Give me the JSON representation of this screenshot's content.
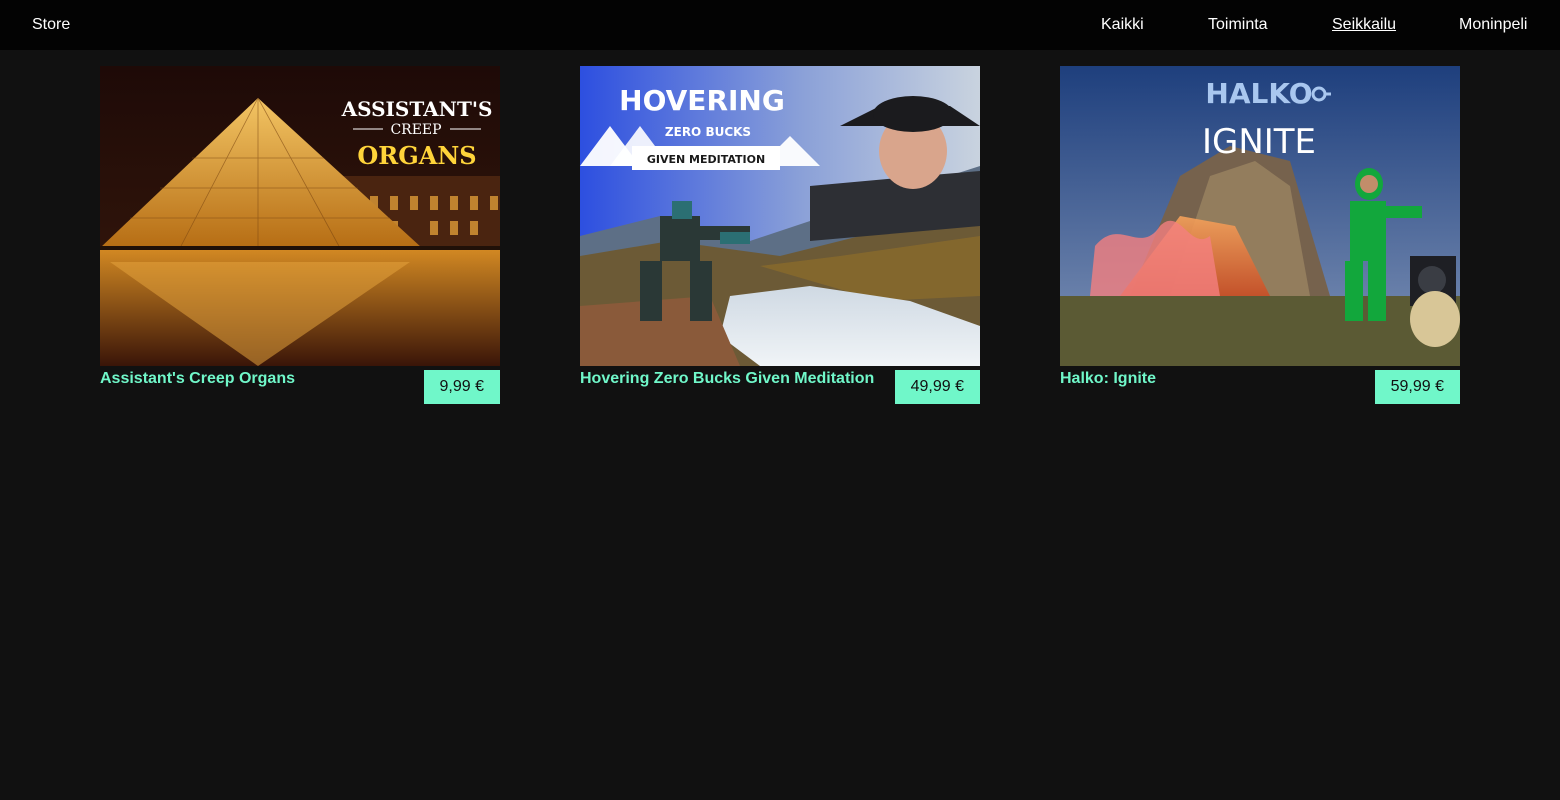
{
  "header": {
    "brand": "Store",
    "nav": [
      {
        "label": "Kaikki",
        "active": false
      },
      {
        "label": "Toiminta",
        "active": false
      },
      {
        "label": "Seikkailu",
        "active": true
      },
      {
        "label": "Moninpeli",
        "active": false
      }
    ]
  },
  "games": [
    {
      "title": "Assistant's Creep Organs",
      "price": "9,99 €",
      "cover": {
        "line1": "ASSISTANT'S",
        "line2": "CREEP",
        "line3": "ORGANS"
      }
    },
    {
      "title": "Hovering Zero Bucks Given Meditation",
      "price": "49,99 €",
      "cover": {
        "line1": "HOVERING",
        "line2": "ZERO BUCKS",
        "line3": "GIVEN MEDITATION"
      }
    },
    {
      "title": "Halko: Ignite",
      "price": "59,99 €",
      "cover": {
        "line1": "HALKO",
        "line2": "IGNITE"
      }
    }
  ],
  "colors": {
    "accent": "#70f7c9",
    "background": "#111111",
    "topbar": "#030303"
  }
}
